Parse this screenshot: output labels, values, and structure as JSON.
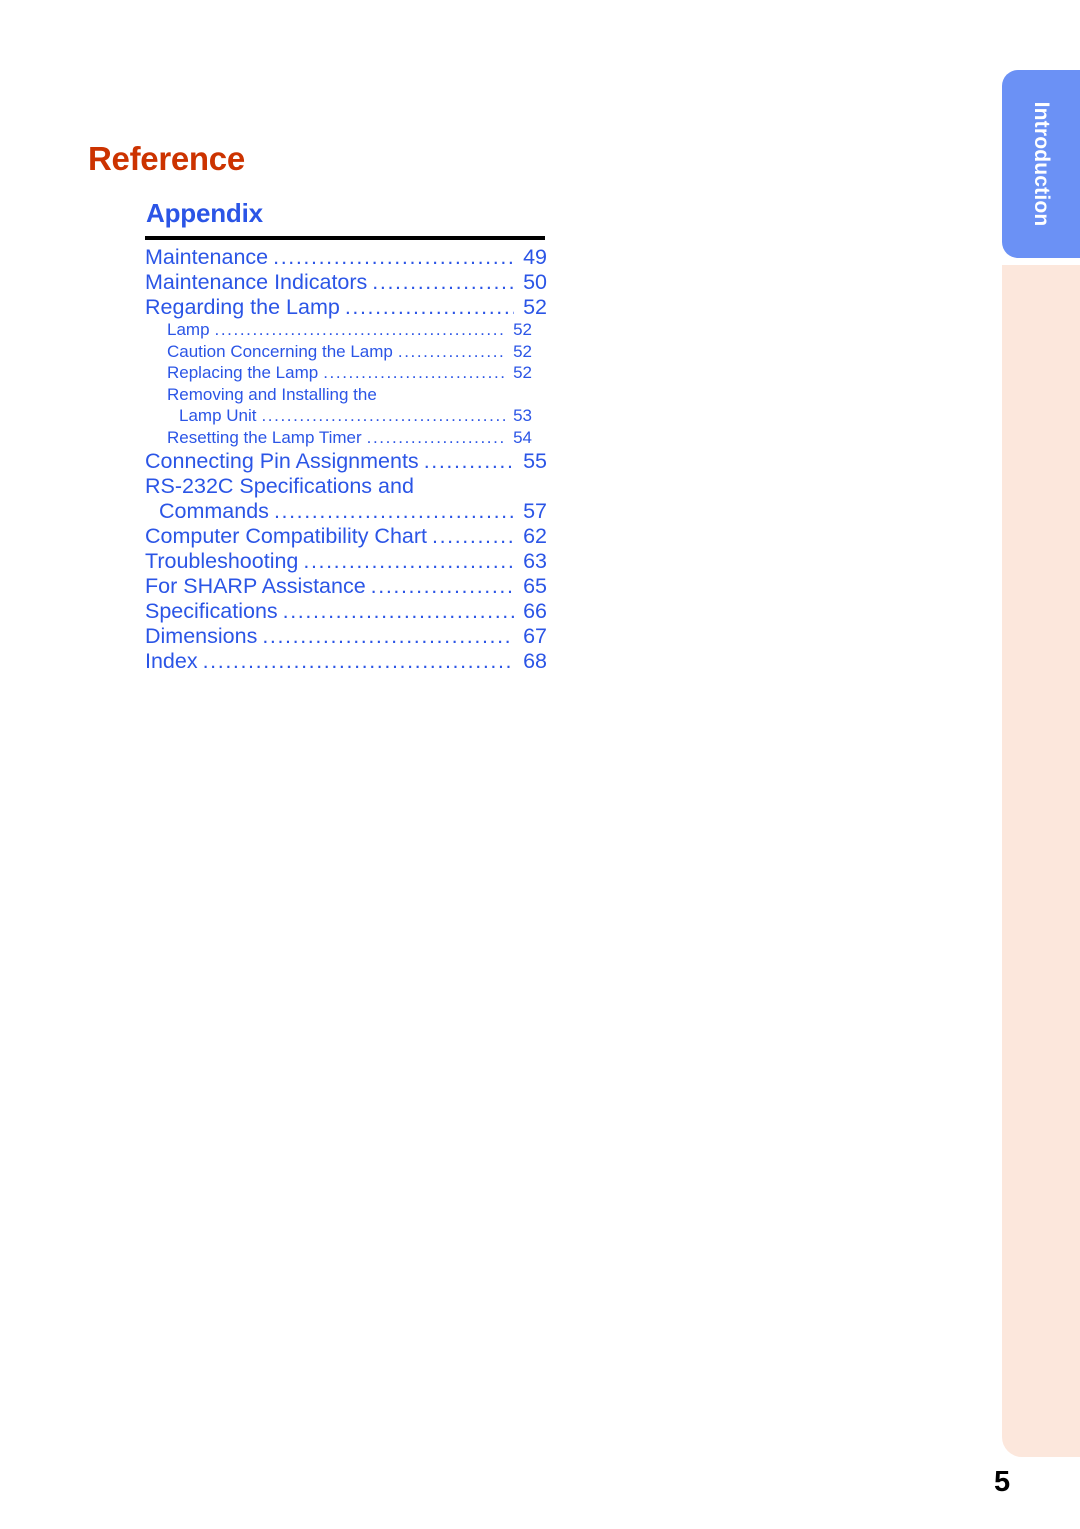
{
  "page": {
    "number": "5",
    "section_tab": "Introduction",
    "tab_color": "#6b91f5",
    "strip_color": "#fce7dc"
  },
  "headings": {
    "reference": "Reference",
    "reference_color": "#cc3300",
    "appendix": "Appendix",
    "appendix_color": "#2b55e6"
  },
  "toc": {
    "leader_dots": "................................................................................",
    "entries": [
      {
        "level": 1,
        "title": "Maintenance",
        "page": "49",
        "wrapped": false,
        "continuation": false
      },
      {
        "level": 1,
        "title": "Maintenance Indicators",
        "page": "50",
        "wrapped": false,
        "continuation": false
      },
      {
        "level": 1,
        "title": "Regarding the Lamp",
        "page": "52",
        "wrapped": false,
        "continuation": false
      },
      {
        "level": 2,
        "title": "Lamp",
        "page": "52",
        "wrapped": false,
        "continuation": false
      },
      {
        "level": 2,
        "title": "Caution Concerning the Lamp",
        "page": "52",
        "wrapped": false,
        "continuation": false
      },
      {
        "level": 2,
        "title": "Replacing the Lamp",
        "page": "52",
        "wrapped": false,
        "continuation": false
      },
      {
        "level": 2,
        "title": "Removing and Installing the",
        "page": "",
        "wrapped": true,
        "continuation": false
      },
      {
        "level": 2,
        "title": "Lamp Unit",
        "page": "53",
        "wrapped": false,
        "continuation": true
      },
      {
        "level": 2,
        "title": "Resetting the Lamp Timer",
        "page": "54",
        "wrapped": false,
        "continuation": false
      },
      {
        "level": 1,
        "title": "Connecting Pin Assignments",
        "page": "55",
        "wrapped": false,
        "continuation": false
      },
      {
        "level": 1,
        "title": "RS-232C Specifications and",
        "page": "",
        "wrapped": true,
        "continuation": false
      },
      {
        "level": 1,
        "title": "Commands",
        "page": "57",
        "wrapped": false,
        "continuation": true
      },
      {
        "level": 1,
        "title": "Computer Compatibility Chart",
        "page": "62",
        "wrapped": false,
        "continuation": false
      },
      {
        "level": 1,
        "title": "Troubleshooting",
        "page": "63",
        "wrapped": false,
        "continuation": false
      },
      {
        "level": 1,
        "title": "For SHARP Assistance",
        "page": "65",
        "wrapped": false,
        "continuation": false
      },
      {
        "level": 1,
        "title": "Specifications",
        "page": "66",
        "wrapped": false,
        "continuation": false
      },
      {
        "level": 1,
        "title": "Dimensions",
        "page": "67",
        "wrapped": false,
        "continuation": false
      },
      {
        "level": 1,
        "title": "Index",
        "page": "68",
        "wrapped": false,
        "continuation": false
      }
    ]
  }
}
